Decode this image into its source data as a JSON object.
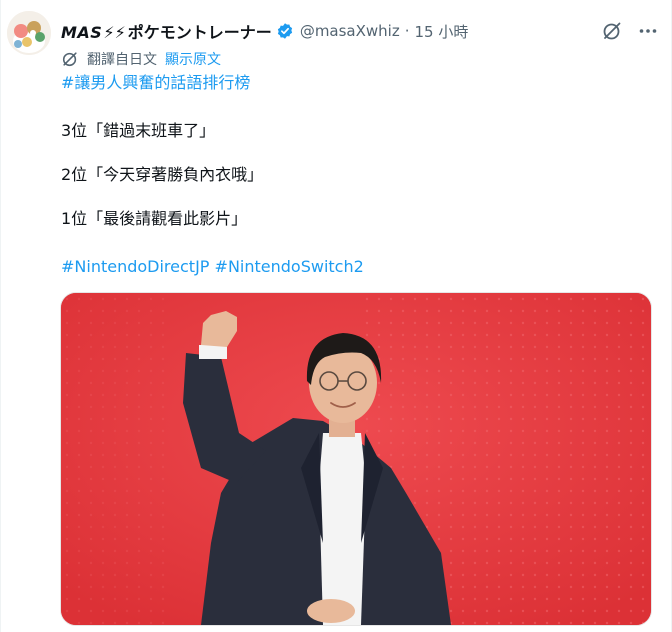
{
  "author": {
    "display_name_latin": "MAS",
    "display_name_bolt": "⚡⚡",
    "display_name_jp": "ポケモントレーナー",
    "handle": "@masaXwhiz",
    "separator": "·",
    "time": "15 小時"
  },
  "translation": {
    "translated_from": "翻譯自日文",
    "show_original": "顯示原文"
  },
  "tweet": {
    "hashtag_title": "#讓男人興奮的話語排行榜",
    "rank3": "3位「錯過末班車了」",
    "rank2": "2位「今天穿著勝負內衣哦」",
    "rank1": "1位「最後請觀看此影片」",
    "hashtag_1": "#NintendoDirectJP",
    "hashtag_2": "#NintendoSwitch2"
  },
  "icons": {
    "verified": "verified-badge-icon",
    "grok": "grok-icon",
    "more": "more-icon",
    "translate": "translate-icon"
  },
  "colors": {
    "accent": "#1d9bf0",
    "media_background": "#e63a3e"
  }
}
